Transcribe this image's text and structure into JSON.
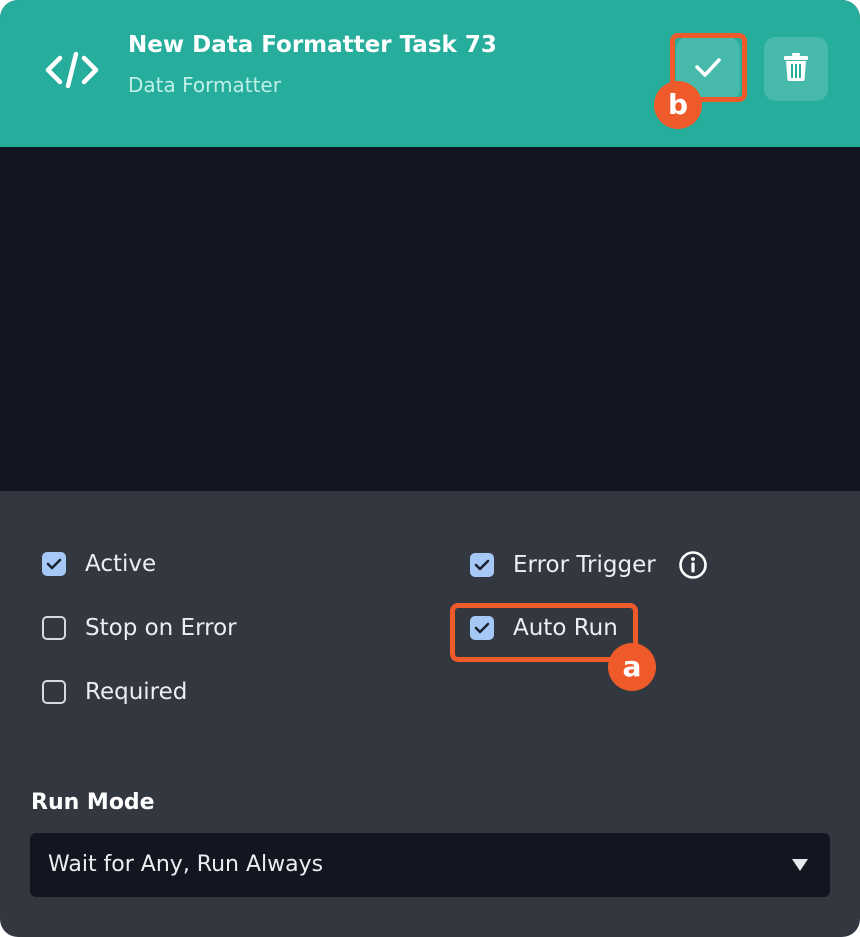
{
  "header": {
    "title": "New Data Formatter Task 73",
    "subtitle": "Data Formatter",
    "icon": "code-icon",
    "confirm_icon": "check-icon",
    "delete_icon": "trash-icon",
    "background_color": "#26ad9b"
  },
  "options": {
    "active": {
      "label": "Active",
      "checked": true
    },
    "stop_on_error": {
      "label": "Stop on Error",
      "checked": false
    },
    "required": {
      "label": "Required",
      "checked": false
    },
    "error_trigger": {
      "label": "Error Trigger",
      "checked": true,
      "icon": "info-icon"
    },
    "auto_run": {
      "label": "Auto Run",
      "checked": true
    }
  },
  "run_mode": {
    "label": "Run Mode",
    "selected": "Wait for Any, Run Always"
  },
  "annotations": {
    "a": "a",
    "b": "b",
    "color": "#ef5a2a"
  }
}
